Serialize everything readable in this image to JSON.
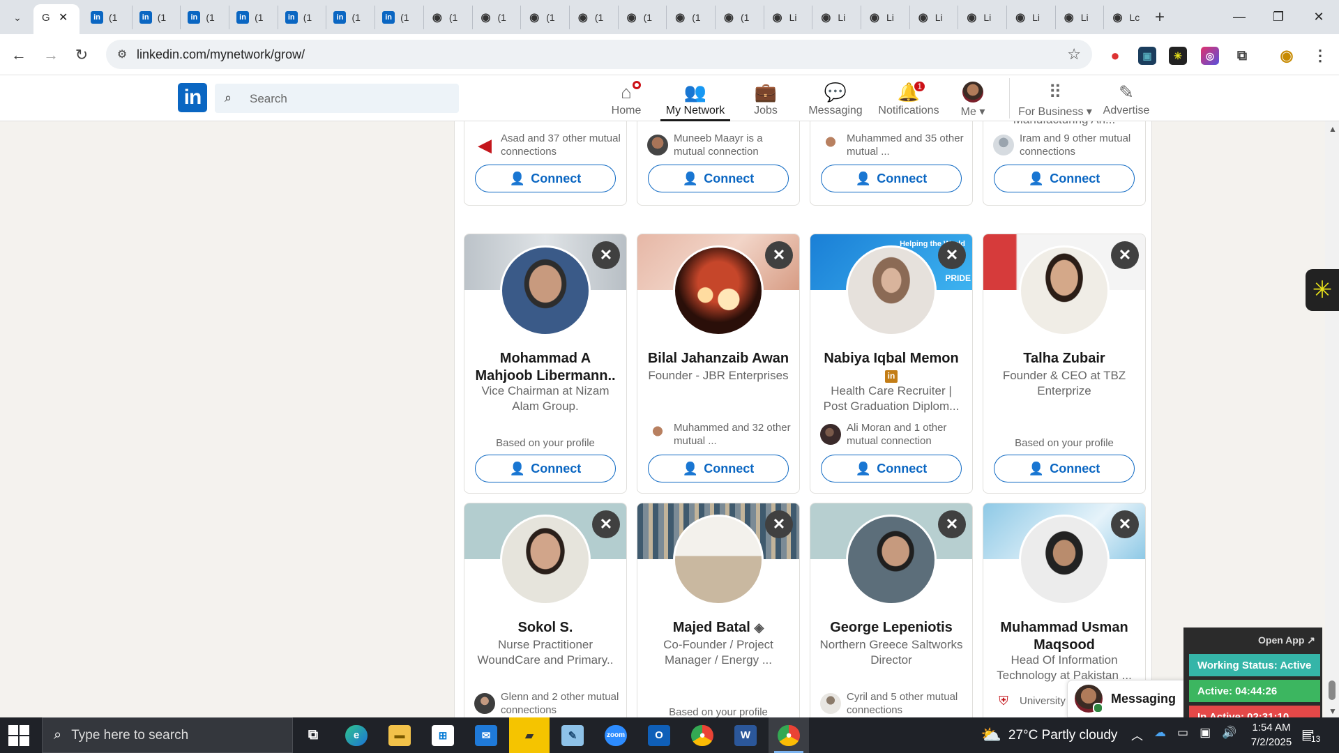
{
  "browser": {
    "active_tab": {
      "title": "G"
    },
    "tabs": [
      {
        "icon": "linkedin-icon",
        "label": "(1"
      },
      {
        "icon": "linkedin-icon",
        "label": "(1"
      },
      {
        "icon": "linkedin-icon",
        "label": "(1"
      },
      {
        "icon": "linkedin-icon",
        "label": "(1"
      },
      {
        "icon": "linkedin-icon",
        "label": "(1"
      },
      {
        "icon": "linkedin-icon",
        "label": "(1"
      },
      {
        "icon": "linkedin-icon",
        "label": "(1"
      },
      {
        "icon": "site-icon",
        "label": "(1"
      },
      {
        "icon": "site-icon",
        "label": "(1"
      },
      {
        "icon": "site-icon",
        "label": "(1"
      },
      {
        "icon": "site-icon",
        "label": "(1"
      },
      {
        "icon": "site-icon",
        "label": "(1"
      },
      {
        "icon": "site-icon",
        "label": "(1"
      },
      {
        "icon": "site-icon",
        "label": "(1"
      },
      {
        "icon": "site-icon",
        "label": "Li"
      },
      {
        "icon": "site-icon",
        "label": "Li"
      },
      {
        "icon": "site-icon",
        "label": "Li"
      },
      {
        "icon": "site-icon",
        "label": "Li"
      },
      {
        "icon": "site-icon",
        "label": "Li"
      },
      {
        "icon": "site-icon",
        "label": "Li"
      },
      {
        "icon": "site-icon",
        "label": "Li"
      },
      {
        "icon": "site-icon",
        "label": "Lc"
      }
    ],
    "url": "linkedin.com/mynetwork/grow/"
  },
  "linkedin": {
    "logo": "in",
    "search_placeholder": "Search",
    "nav": [
      {
        "label": "Home",
        "icon": "home-icon"
      },
      {
        "label": "My Network",
        "icon": "my-network-icon"
      },
      {
        "label": "Jobs",
        "icon": "jobs-icon"
      },
      {
        "label": "Messaging",
        "icon": "messaging-icon"
      },
      {
        "label": "Notifications",
        "icon": "notifications-icon",
        "badge": "1"
      },
      {
        "label": "Me",
        "icon": "avatar"
      },
      {
        "label": "For Business",
        "icon": "grid-icon"
      },
      {
        "label": "Advertise",
        "icon": "advertise-icon"
      }
    ],
    "connect_label": "Connect"
  },
  "cards_top_row": [
    {
      "headline_tail": "",
      "mutual": "Asad and 37 other mutual connections"
    },
    {
      "headline_tail": "",
      "mutual": "Muneeb Maayr is a mutual connection"
    },
    {
      "headline_tail": "",
      "mutual": "Muhammed and 35 other mutual ..."
    },
    {
      "headline_tail": "Non-dairy Specialist | Food Manufacturing An...",
      "mutual": "Iram and 9 other mutual connections"
    }
  ],
  "cards_row2": [
    {
      "name": "Mohammad A Mahjoob Libermann..",
      "headline": "Vice Chairman at Nizam Alam Group.",
      "based": "Based on your profile",
      "mutual": ""
    },
    {
      "name": "Bilal Jahanzaib Awan",
      "headline": "Founder - JBR Enterprises",
      "based": "",
      "mutual": "Muhammed and 32 other mutual ..."
    },
    {
      "name": "Nabiya Iqbal Memon",
      "headline": "Health Care Recruiter | Post Graduation Diplom...",
      "based": "",
      "mutual": "Ali Moran and 1 other mutual connection",
      "banner_text": "Helping the World",
      "banner_brand": "PRIDE"
    },
    {
      "name": "Talha Zubair",
      "headline": "Founder & CEO at TBZ Enterprize",
      "based": "Based on your profile",
      "mutual": ""
    }
  ],
  "cards_row3": [
    {
      "name": "Sokol S.",
      "headline": "Nurse Practitioner WoundCare and Primary..",
      "based": "",
      "mutual": "Glenn and 2 other mutual connections"
    },
    {
      "name": "Majed Batal",
      "headline": "Co-Founder / Project Manager / Energy ...",
      "based": "Based on your profile",
      "mutual": ""
    },
    {
      "name": "George Lepeniotis",
      "headline": "Northern Greece Saltworks Director",
      "based": "",
      "mutual": "Cyril and 5 other mutual connections"
    },
    {
      "name": "Muhammad Usman Maqsood",
      "headline": "Head Of Information Technology at Pakistan ...",
      "based": "",
      "mutual": "University"
    }
  ],
  "messaging_label": "Messaging",
  "work_status": {
    "open_app": "Open App ↗",
    "status": "Working Status: Active",
    "active": "Active: 04:44:26",
    "inactive": "In Active: 02:31:10"
  },
  "taskbar": {
    "search_placeholder": "Type here to search",
    "weather": "27°C  Partly cloudy",
    "time": "1:54 AM",
    "date": "7/2/2025",
    "notifications": "13"
  }
}
